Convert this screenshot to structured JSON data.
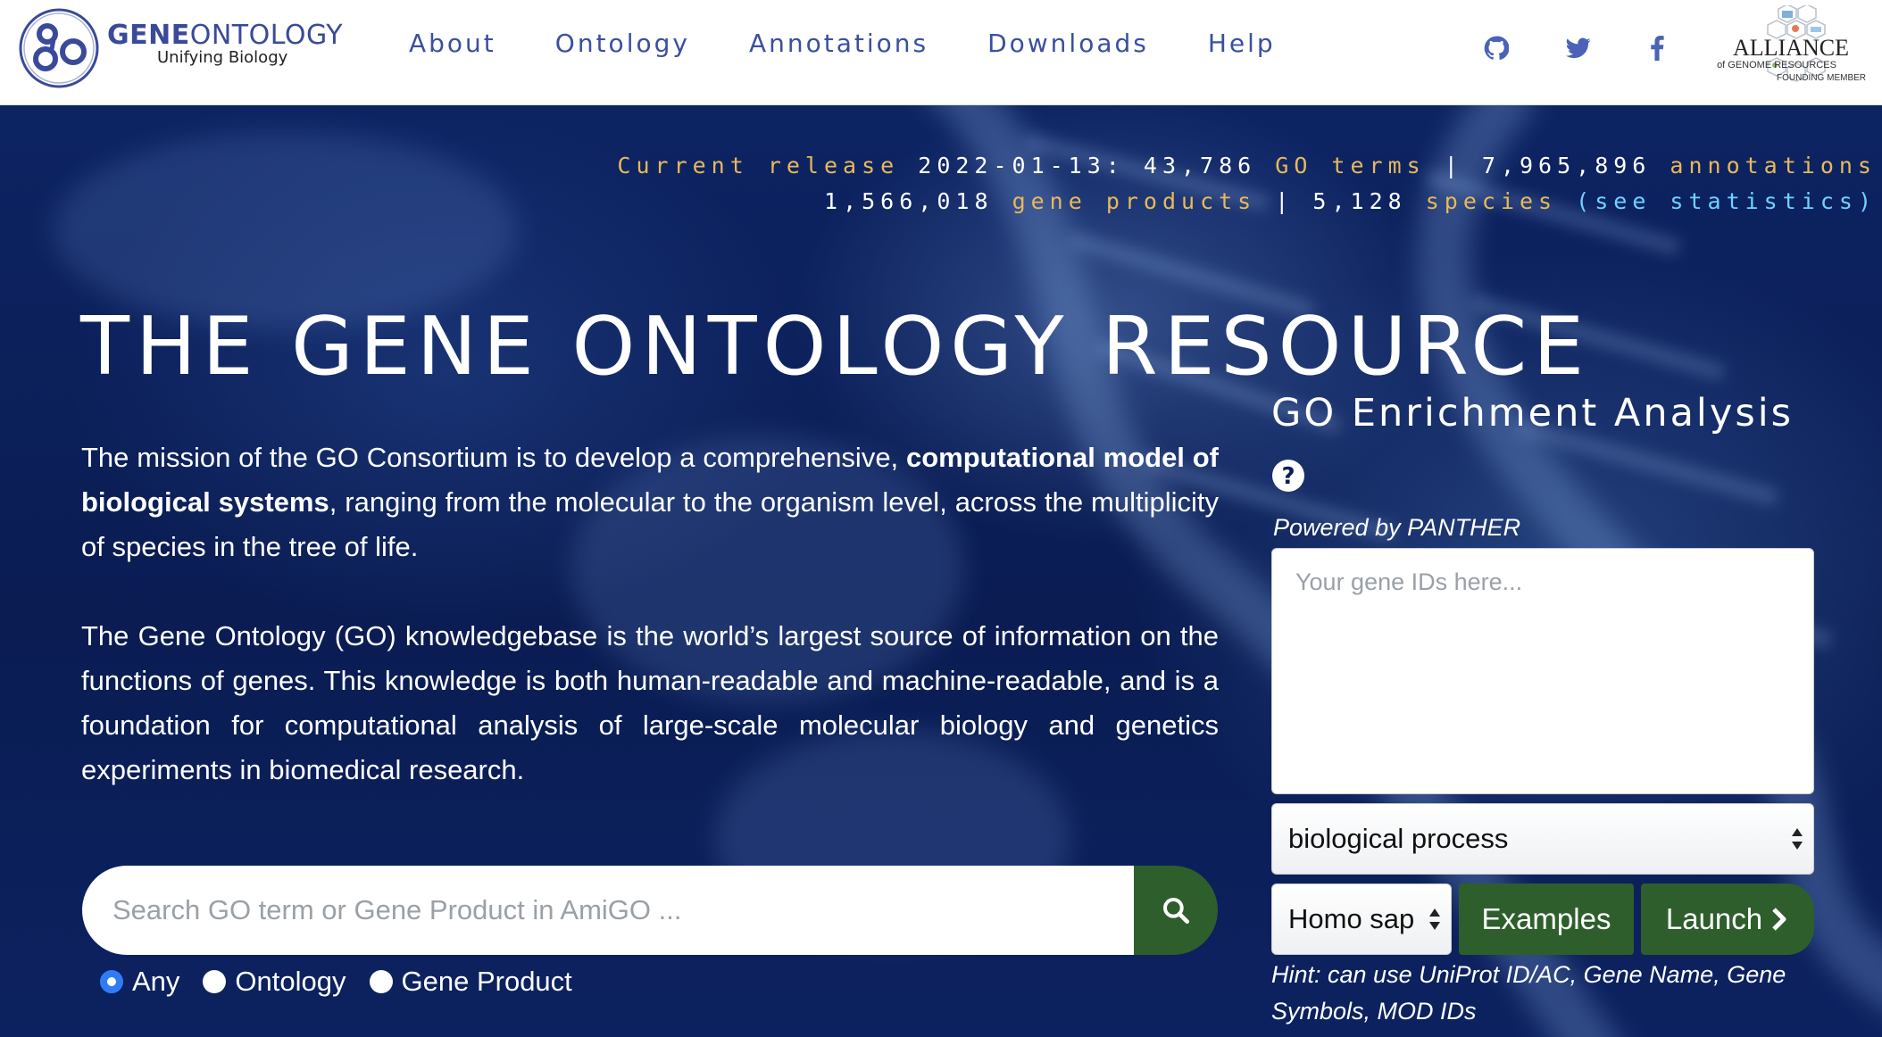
{
  "header": {
    "logo_title_bold": "GENE",
    "logo_title_thin": "ONTOLOGY",
    "logo_subtitle": "Unifying Biology",
    "nav": [
      {
        "label": "About"
      },
      {
        "label": "Ontology"
      },
      {
        "label": "Annotations"
      },
      {
        "label": "Downloads"
      },
      {
        "label": "Help"
      }
    ],
    "social_icons": [
      "github-icon",
      "twitter-icon",
      "facebook-icon"
    ],
    "alliance": {
      "name": "ALLIANCE",
      "line2": "of GENOME RESOURCES",
      "line3": "FOUNDING MEMBER"
    }
  },
  "stats": {
    "release_label": "Current release",
    "release_date": "2022-01-13:",
    "terms_count": "43,786",
    "terms_label": "GO terms",
    "separator": "|",
    "annotations_count": "7,965,896",
    "annotations_label": "annotations",
    "gene_products_count": "1,566,018",
    "gene_products_label": "gene products",
    "species_count": "5,128",
    "species_label": "species",
    "statistics_link": "(see statistics)"
  },
  "hero": {
    "title": "THE GENE ONTOLOGY RESOURCE",
    "mission_p1_a": "The mission of the GO Consortium is to develop a comprehensive, ",
    "mission_p1_bold": "computational model of biological systems",
    "mission_p1_b": ", ranging from the molecular to the organism level, across the multiplicity of species in the tree of life.",
    "mission_p2": "The Gene Ontology (GO) knowledgebase is the world’s largest source of information on the functions of genes. This knowledge is both human-readable and machine-readable, and is a foundation for computational analysis of large-scale molecular biology and genetics experiments in biomedical research."
  },
  "search": {
    "placeholder": "Search GO term or Gene Product in AmiGO ...",
    "value": "",
    "options": [
      {
        "label": "Any",
        "checked": true
      },
      {
        "label": "Ontology",
        "checked": false
      },
      {
        "label": "Gene Product",
        "checked": false
      }
    ]
  },
  "enrichment": {
    "title": "GO Enrichment Analysis",
    "powered_by": "Powered by PANTHER",
    "gene_ids_placeholder": "Your gene IDs here...",
    "aspect_selected": "biological process",
    "species_selected": "Homo sapiens",
    "examples_label": "Examples",
    "launch_label": "Launch",
    "hint": "Hint: can use UniProt ID/AC, Gene Name, Gene Symbols, MOD IDs"
  },
  "colors": {
    "accent_blue": "#3b4fa0",
    "button_green": "#2e5e2c",
    "stats_gold": "#e8b85a",
    "stats_cyan": "#6fd2ff",
    "hero_navy": "#0b1f55"
  }
}
